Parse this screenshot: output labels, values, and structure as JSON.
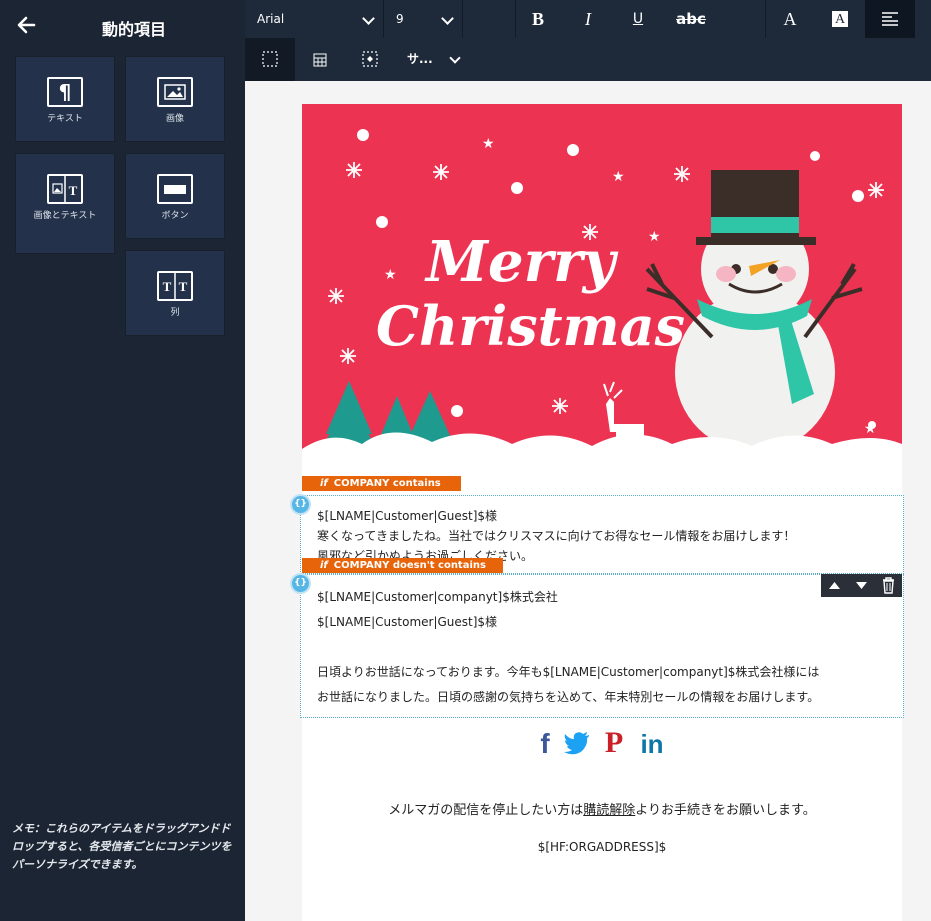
{
  "sidebar": {
    "title": "動的項目",
    "items": [
      {
        "label": "テキスト",
        "icon": "paragraph-icon"
      },
      {
        "label": "画像",
        "icon": "image-icon"
      },
      {
        "label": "画像とテキスト",
        "icon": "image-text-icon"
      },
      {
        "label": "ボタン",
        "icon": "button-icon"
      },
      {
        "label": "列",
        "icon": "columns-icon"
      }
    ],
    "memo": "メモ：これらのアイテムをドラッグアンドドロップすると、各受信者ごとにコンテンツをパーソナライズできます。"
  },
  "toolbar": {
    "font": "Arial",
    "size": "9",
    "bold": "B",
    "italic": "I",
    "underline": "U",
    "strike": "abc",
    "font_color": "A",
    "bg_color": "A",
    "row2_dropdown": "サ..."
  },
  "banner": {
    "line1": "Merry",
    "line2": "Christmas"
  },
  "blocks": [
    {
      "condition_if": "if",
      "condition": "COMPANY contains",
      "lines": [
        "$[LNAME|Customer|Guest]$様",
        "寒くなってきましたね。当社ではクリスマスに向けてお得なセール情報をお届けします！",
        "風邪など引かぬようお過ごしください。"
      ]
    },
    {
      "condition_if": "if",
      "condition": "COMPANY doesn't contains",
      "lines": [
        "$[LNAME|Customer|companyt]$株式会社",
        "$[LNAME|Customer|Guest]$様",
        "",
        "日頃よりお世話になっております。今年も$[LNAME|Customer|companyt]$株式会社様には",
        "お世話になりました。日頃の感謝の気持ちを込めて、年末特別セールの情報をお届けします。"
      ]
    }
  ],
  "footer": {
    "unsub_before": "メルマガの配信を停止したい方は",
    "unsub_link": "購読解除",
    "unsub_after": "よりお手続きをお願いします。",
    "address": "$[HF:ORGADDRESS]$"
  },
  "colors": {
    "sidebar_bg": "#1c2533",
    "tile_bg": "#23324a",
    "banner_red": "#ec3452",
    "condition_orange": "#e8640a",
    "dynamic_blue": "#56b6e6",
    "facebook": "#3b5998",
    "twitter": "#1da1f2",
    "pinterest": "#cb2027",
    "linkedin": "#0e76a8"
  }
}
